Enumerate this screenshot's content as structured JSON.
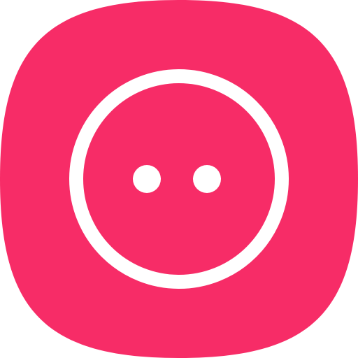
{
  "app_icon": {
    "name": "face-icon",
    "colors": {
      "background": "#ffffff",
      "tile": "#F72C67",
      "glyph": "#ffffff"
    },
    "shapes": {
      "outer_shape": "rounded-square",
      "inner_glyph": "ring-with-two-dots"
    }
  }
}
